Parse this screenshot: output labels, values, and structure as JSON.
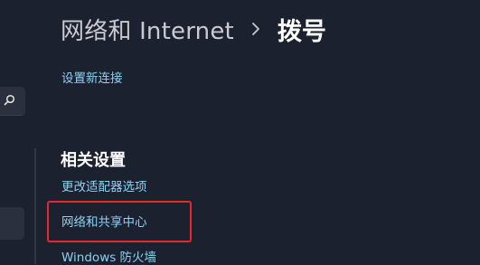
{
  "breadcrumb": {
    "parent": "网络和 Internet",
    "current": "拨号"
  },
  "links": {
    "setup_new_connection": "设置新连接"
  },
  "related_settings": {
    "heading": "相关设置",
    "items": [
      {
        "label": "更改适配器选项"
      },
      {
        "label": "网络和共享中心"
      },
      {
        "label": "Windows 防火墙"
      }
    ]
  },
  "annotation": {
    "highlight_color": "#e8262b"
  },
  "colors": {
    "background": "#1c2130",
    "link": "#8fd0ef",
    "text": "#ffffff",
    "breadcrumb_parent": "#c9cbd0"
  },
  "icons": {
    "search": "search-icon",
    "breadcrumb_separator": "chevron-right-icon"
  }
}
